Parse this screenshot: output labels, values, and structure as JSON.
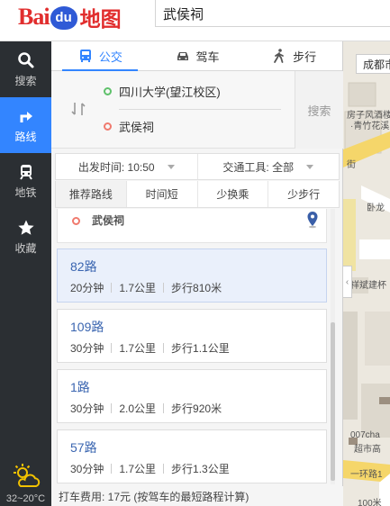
{
  "header": {
    "logo_bai": "Bai",
    "logo_du": "du",
    "logo_map": "地图",
    "search_value": "武侯祠"
  },
  "nav": {
    "items": [
      {
        "label": "搜索",
        "icon": "search-icon"
      },
      {
        "label": "路线",
        "icon": "route-icon",
        "active": true
      },
      {
        "label": "地铁",
        "icon": "subway-icon"
      },
      {
        "label": "收藏",
        "icon": "star-icon"
      }
    ],
    "weather_temp": "32~20°C"
  },
  "tabs": [
    {
      "label": "公交",
      "icon": "bus-icon",
      "active": true
    },
    {
      "label": "驾车",
      "icon": "car-icon"
    },
    {
      "label": "步行",
      "icon": "walk-icon"
    }
  ],
  "route": {
    "from": "四川大学(望江校区)",
    "to": "武侯祠",
    "search_label": "搜索"
  },
  "filters": {
    "depart": "出发时间: 10:50",
    "tool": "交通工具: 全部"
  },
  "sorts": [
    "推荐路线",
    "时间短",
    "少换乘",
    "少步行"
  ],
  "destination_label": "武侯祠",
  "results": [
    {
      "name": "82路",
      "time": "20分钟",
      "distance": "1.7公里",
      "walk": "步行810米",
      "selected": true
    },
    {
      "name": "109路",
      "time": "30分钟",
      "distance": "1.7公里",
      "walk": "步行1.1公里"
    },
    {
      "name": "1路",
      "time": "30分钟",
      "distance": "2.0公里",
      "walk": "步行920米"
    },
    {
      "name": "57路",
      "time": "30分钟",
      "distance": "1.7公里",
      "walk": "步行1.3公里"
    }
  ],
  "footer": "打车费用: 17元 (按驾车的最短路程计算)",
  "map": {
    "city": "成都市",
    "labels": [
      "房子风酒楼",
      "·青竹花溪",
      "街",
      "卧龙",
      "祥斌建杯",
      "007cha",
      "超市高",
      "一环路1",
      "100米"
    ]
  }
}
